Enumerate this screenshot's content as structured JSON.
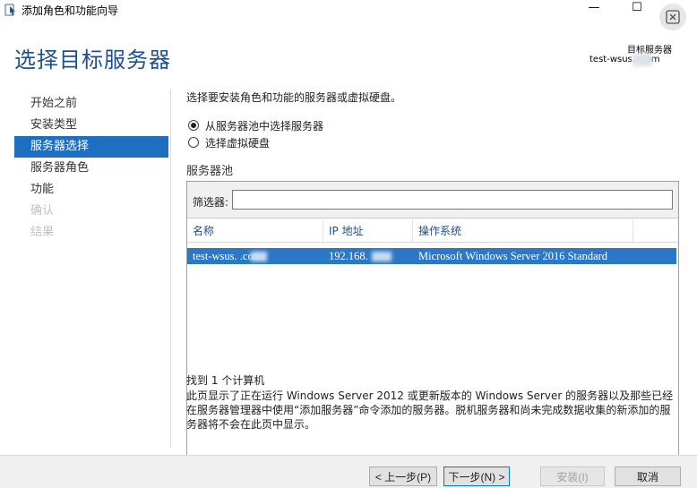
{
  "window": {
    "title": "添加角色和功能向导",
    "minimize_glyph": "—",
    "maximize_glyph": "☐"
  },
  "header": {
    "page_title": "选择目标服务器",
    "dest_label": "目标服务器",
    "dest_server": "test-wsus.      .com"
  },
  "nav": {
    "items": [
      {
        "label": "开始之前",
        "state": "normal"
      },
      {
        "label": "安装类型",
        "state": "normal"
      },
      {
        "label": "服务器选择",
        "state": "active"
      },
      {
        "label": "服务器角色",
        "state": "normal"
      },
      {
        "label": "功能",
        "state": "normal"
      },
      {
        "label": "确认",
        "state": "disabled"
      },
      {
        "label": "结果",
        "state": "disabled"
      }
    ]
  },
  "main": {
    "intro": "选择要安装角色和功能的服务器或虚拟硬盘。",
    "radio_pool": "从服务器池中选择服务器",
    "radio_vhd": "选择虚拟硬盘",
    "pool_title": "服务器池",
    "filter_label": "筛选器:",
    "filter_value": "",
    "columns": [
      "名称",
      "IP 地址",
      "操作系统"
    ],
    "rows": [
      {
        "name": "test-wsus.      .com",
        "ip": "192.168.",
        "os": "Microsoft Windows Server 2016 Standard"
      }
    ],
    "found": "找到 1 个计算机",
    "description": "此页显示了正在运行 Windows Server 2012 或更新版本的 Windows Server 的服务器以及那些已经在服务器管理器中使用“添加服务器”命令添加的服务器。脱机服务器和尚未完成数据收集的新添加的服务器将不会在此页中显示。"
  },
  "footer": {
    "prev": "< 上一步(P)",
    "next": "下一步(N) >",
    "install": "安装(I)",
    "cancel": "取消"
  },
  "colors": {
    "accent": "#1e6fbf",
    "title_blue": "#1e4f8f",
    "selected_row": "#2a78c7"
  }
}
